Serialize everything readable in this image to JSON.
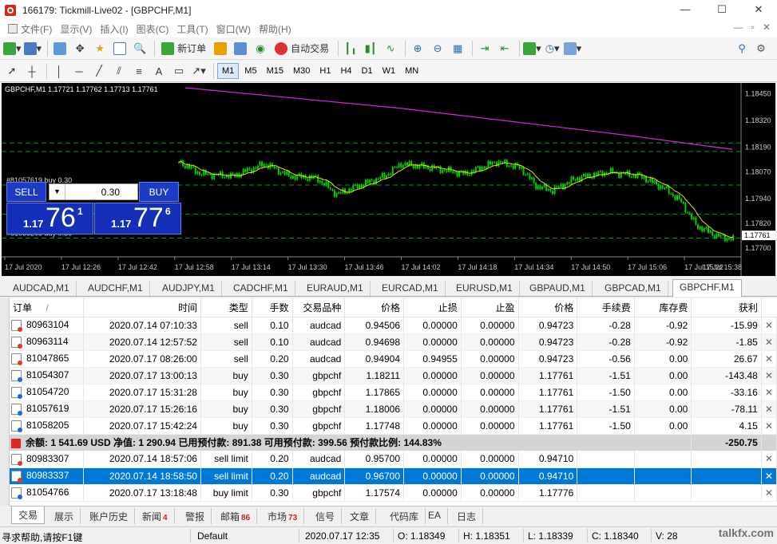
{
  "window": {
    "title": "166179: Tickmill-Live02 - [GBPCHF,M1]",
    "min": "—",
    "max": "☐",
    "close": "✕"
  },
  "menu": {
    "items": [
      "文件(F)",
      "显示(V)",
      "插入(I)",
      "图表(C)",
      "工具(T)",
      "窗口(W)",
      "帮助(H)"
    ],
    "mdi": [
      "—",
      "▫",
      "✕"
    ]
  },
  "toolbar": {
    "new_order": "新订单",
    "auto_trading": "自动交易"
  },
  "timeframes": [
    "M1",
    "M5",
    "M15",
    "M30",
    "H1",
    "H4",
    "D1",
    "W1",
    "MN"
  ],
  "timeframe_active": "M1",
  "chart": {
    "info": "GBPCHF,M1  1.17721 1.17762 1.17713 1.17761",
    "trade_panel": {
      "sell": "SELL",
      "buy": "BUY",
      "volume": "0.30",
      "sell_small": "1.17",
      "sell_big": "76",
      "sell_sup": "1",
      "buy_small": "1.17",
      "buy_big": "77",
      "buy_sup": "6"
    },
    "order_lines": [
      "#81057619 buy 0.30",
      "#81054720 buy 0.30",
      "#81058205 buy 0.30"
    ],
    "price_labels": [
      "1.18450",
      "1.18320",
      "1.18190",
      "1.18070",
      "1.17940",
      "1.17820",
      "1.17700"
    ],
    "current_price": "1.17761",
    "time_labels": [
      "17 Jul 2020",
      "17 Jul 12:26",
      "17 Jul 12:42",
      "17 Jul 12:58",
      "17 Jul 13:14",
      "17 Jul 13:30",
      "17 Jul 13:46",
      "17 Jul 14:02",
      "17 Jul 14:18",
      "17 Jul 14:34",
      "17 Jul 14:50",
      "17 Jul 15:06",
      "17 Jul 15:22",
      "17 Jul 15:38"
    ],
    "colors": {
      "bull": "#00d000",
      "ma_fast": "#f0e000",
      "ma_slow": "#e020e0",
      "grid_line": "#00a000",
      "bg": "#000000"
    }
  },
  "chart_tabs": [
    "AUDCAD,M1",
    "AUDCHF,M1",
    "AUDJPY,M1",
    "CADCHF,M1",
    "EURAUD,M1",
    "EURCAD,M1",
    "EURUSD,M1",
    "GBPAUD,M1",
    "GBPCAD,M1",
    "GBPCHF,M1"
  ],
  "chart_tab_active": "GBPCHF,M1",
  "table": {
    "headers": [
      "订单",
      "时间",
      "类型",
      "手数",
      "交易品种",
      "价格",
      "止损",
      "止盈",
      "价格",
      "手续费",
      "库存费",
      "获利",
      ""
    ],
    "sort_marker": "/",
    "positions": [
      {
        "order": "80963104",
        "time": "2020.07.14 07:10:33",
        "type": "sell",
        "lots": "0.10",
        "symbol": "audcad",
        "price": "0.94506",
        "sl": "0.00000",
        "tp": "0.00000",
        "cur": "0.94723",
        "comm": "-0.28",
        "swap": "-0.92",
        "profit": "-15.99",
        "icon": "red"
      },
      {
        "order": "80963114",
        "time": "2020.07.14 12:57:52",
        "type": "sell",
        "lots": "0.10",
        "symbol": "audcad",
        "price": "0.94698",
        "sl": "0.00000",
        "tp": "0.00000",
        "cur": "0.94723",
        "comm": "-0.28",
        "swap": "-0.92",
        "profit": "-1.85",
        "icon": "red"
      },
      {
        "order": "81047865",
        "time": "2020.07.17 08:26:00",
        "type": "sell",
        "lots": "0.20",
        "symbol": "audcad",
        "price": "0.94904",
        "sl": "0.94955",
        "tp": "0.00000",
        "cur": "0.94723",
        "comm": "-0.56",
        "swap": "0.00",
        "profit": "26.67",
        "icon": "red"
      },
      {
        "order": "81054307",
        "time": "2020.07.17 13:00:13",
        "type": "buy",
        "lots": "0.30",
        "symbol": "gbpchf",
        "price": "1.18211",
        "sl": "0.00000",
        "tp": "0.00000",
        "cur": "1.17761",
        "comm": "-1.51",
        "swap": "0.00",
        "profit": "-143.48",
        "icon": "blue"
      },
      {
        "order": "81054720",
        "time": "2020.07.17 15:31:28",
        "type": "buy",
        "lots": "0.30",
        "symbol": "gbpchf",
        "price": "1.17865",
        "sl": "0.00000",
        "tp": "0.00000",
        "cur": "1.17761",
        "comm": "-1.50",
        "swap": "0.00",
        "profit": "-33.16",
        "icon": "blue"
      },
      {
        "order": "81057619",
        "time": "2020.07.17 15:26:16",
        "type": "buy",
        "lots": "0.30",
        "symbol": "gbpchf",
        "price": "1.18006",
        "sl": "0.00000",
        "tp": "0.00000",
        "cur": "1.17761",
        "comm": "-1.51",
        "swap": "0.00",
        "profit": "-78.11",
        "icon": "blue"
      },
      {
        "order": "81058205",
        "time": "2020.07.17 15:42:24",
        "type": "buy",
        "lots": "0.30",
        "symbol": "gbpchf",
        "price": "1.17748",
        "sl": "0.00000",
        "tp": "0.00000",
        "cur": "1.17761",
        "comm": "-1.50",
        "swap": "0.00",
        "profit": "4.15",
        "icon": "blue"
      }
    ],
    "summary": {
      "text": "余额: 1 541.69 USD  净值: 1 290.94  已用预付款: 891.38  可用预付款: 399.56  预付款比例: 144.83%",
      "total": "-250.75"
    },
    "pending": [
      {
        "order": "80983307",
        "time": "2020.07.14 18:57:06",
        "type": "sell limit",
        "lots": "0.20",
        "symbol": "audcad",
        "price": "0.95700",
        "sl": "0.00000",
        "tp": "0.00000",
        "cur": "0.94710",
        "icon": "red"
      },
      {
        "order": "80983337",
        "time": "2020.07.14 18:58:50",
        "type": "sell limit",
        "lots": "0.20",
        "symbol": "audcad",
        "price": "0.96700",
        "sl": "0.00000",
        "tp": "0.00000",
        "cur": "0.94710",
        "icon": "red",
        "selected": true
      },
      {
        "order": "81054766",
        "time": "2020.07.17 13:18:48",
        "type": "buy limit",
        "lots": "0.30",
        "symbol": "gbpchf",
        "price": "1.17574",
        "sl": "0.00000",
        "tp": "0.00000",
        "cur": "1.17776",
        "icon": "blue"
      }
    ],
    "close_glyph": "✕"
  },
  "bottom_tabs": [
    {
      "label": "交易",
      "badge": ""
    },
    {
      "label": "展示",
      "badge": ""
    },
    {
      "label": "账户历史",
      "badge": ""
    },
    {
      "label": "新闻",
      "badge": "4"
    },
    {
      "label": "警报",
      "badge": ""
    },
    {
      "label": "邮箱",
      "badge": "86"
    },
    {
      "label": "市场",
      "badge": "73"
    },
    {
      "label": "信号",
      "badge": ""
    },
    {
      "label": "文章",
      "badge": ""
    },
    {
      "label": "代码库",
      "badge": ""
    },
    {
      "label": "EA",
      "badge": ""
    },
    {
      "label": "日志",
      "badge": ""
    }
  ],
  "bottom_tab_active": "交易",
  "statusbar": {
    "help": "寻求帮助,请按F1键",
    "profile": "Default",
    "datetime": "2020.07.17 12:35",
    "open": "O: 1.18349",
    "high": "H: 1.18351",
    "low": "L: 1.18339",
    "close": "C: 1.18340",
    "volume": "V: 28"
  },
  "watermark": "talkfx.com"
}
